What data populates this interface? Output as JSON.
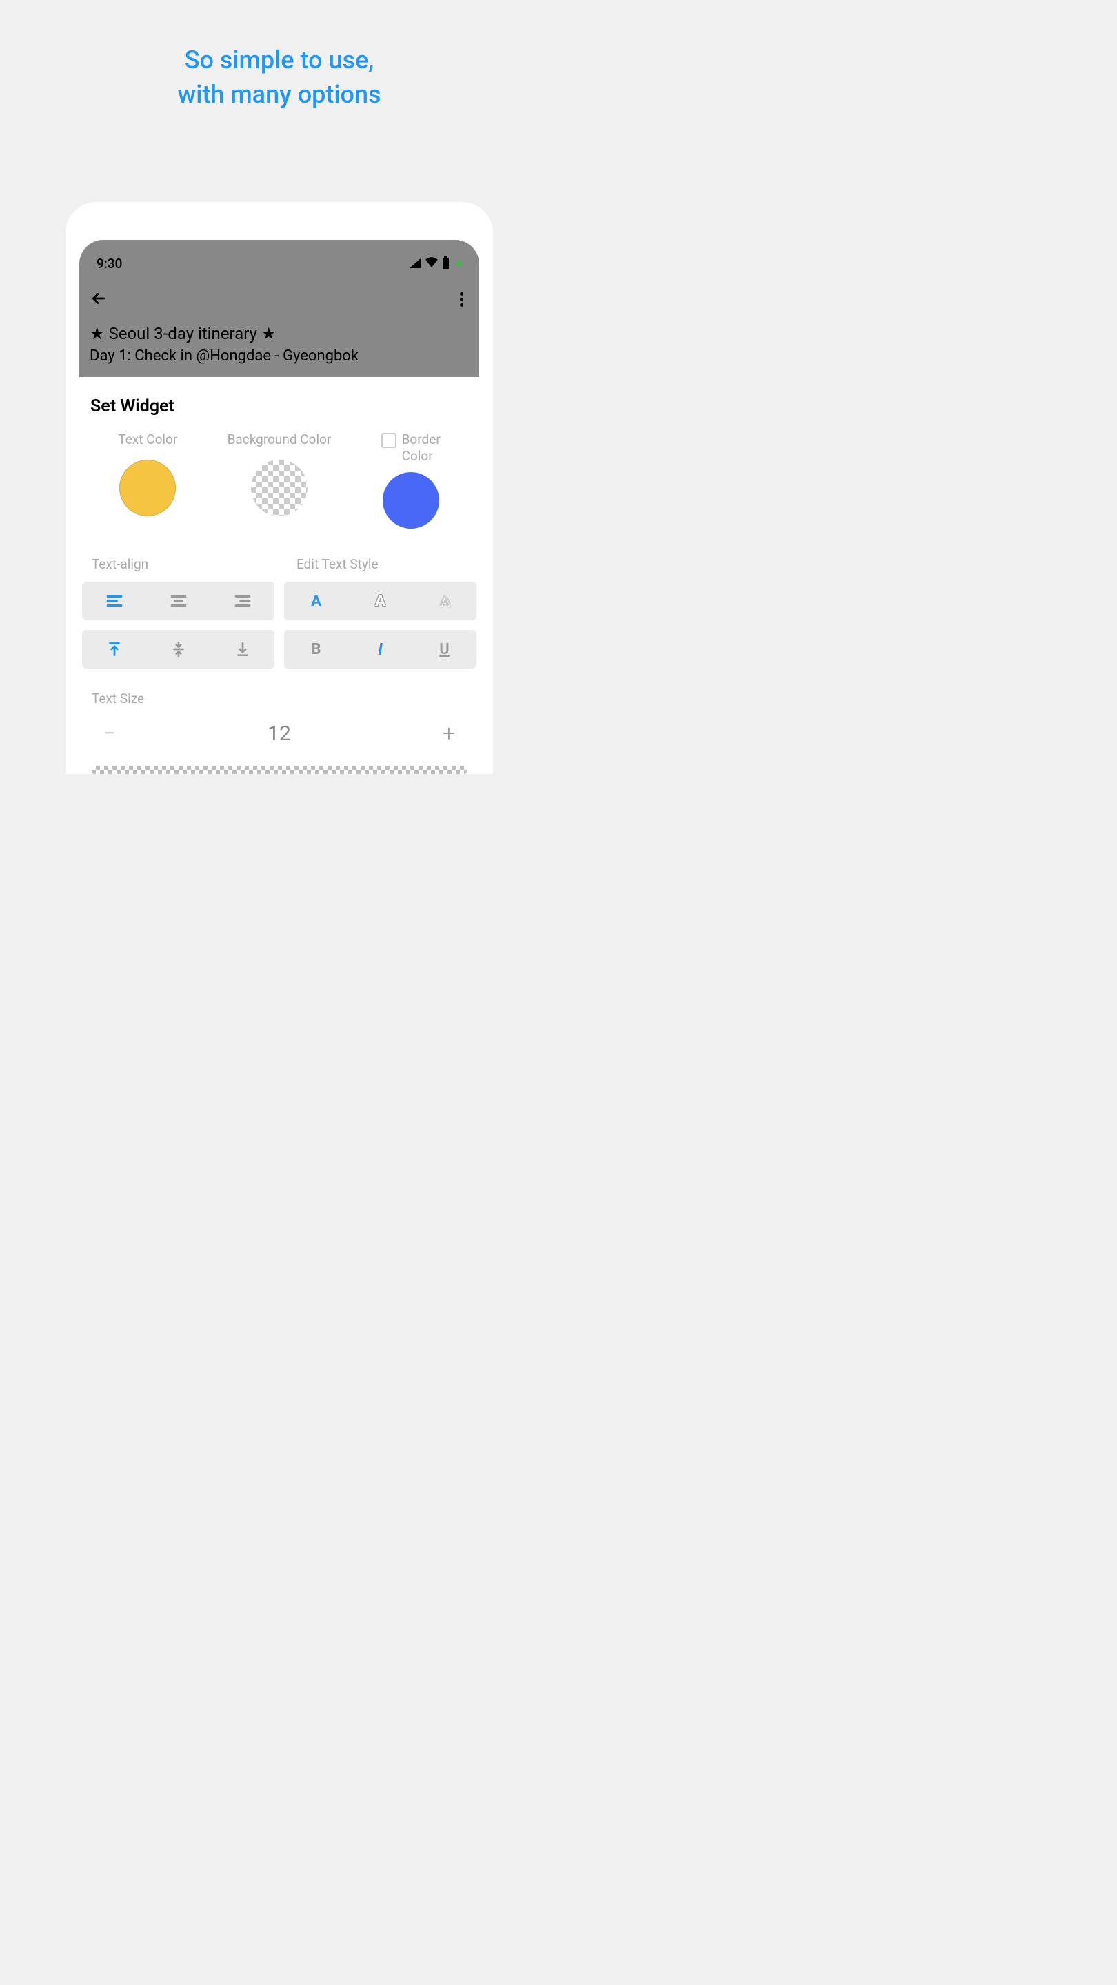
{
  "headline": {
    "line1": "So simple to use,",
    "line2": "with many options"
  },
  "status": {
    "time": "9:30"
  },
  "note": {
    "title": "★ Seoul 3-day itinerary ★",
    "body": "Day 1: Check in @Hongdae - Gyeongbok"
  },
  "sheet": {
    "title": "Set Widget",
    "colors": {
      "text_label": "Text Color",
      "background_label": "Background Color",
      "border_label_line1": "Border",
      "border_label_line2": "Color",
      "text_color": "#f5c542",
      "background_color": "transparent",
      "border_color": "#4968f5"
    },
    "align_label": "Text-align",
    "style_label": "Edit Text Style",
    "size_label": "Text Size",
    "size_value": "12",
    "minus": "−",
    "plus": "+"
  }
}
